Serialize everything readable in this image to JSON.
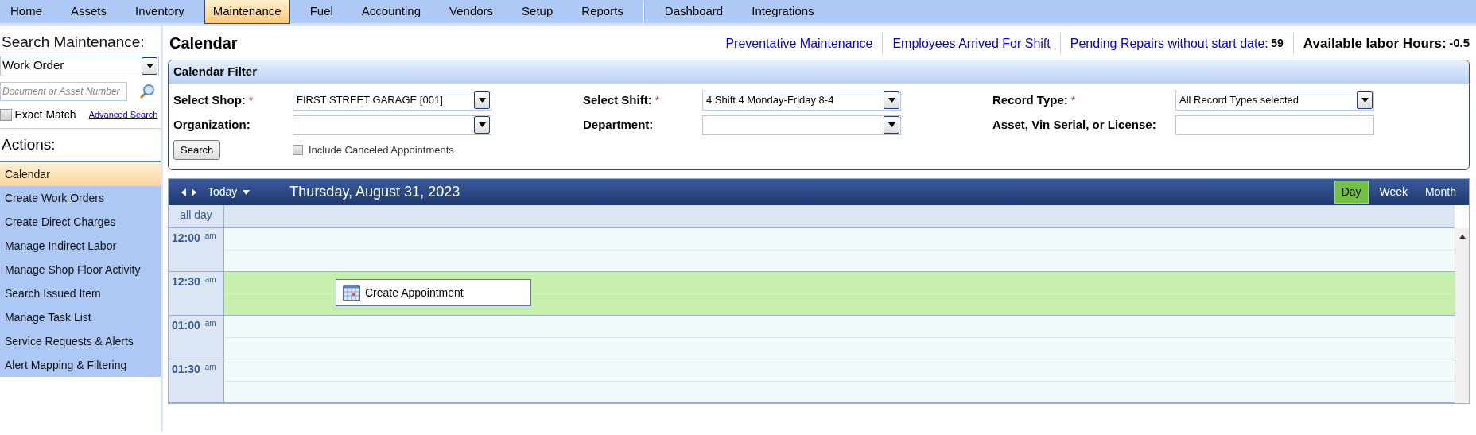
{
  "menu": {
    "main": [
      {
        "label": "Home",
        "selected": false
      },
      {
        "label": "Assets",
        "selected": false
      },
      {
        "label": "Inventory",
        "selected": false
      },
      {
        "label": "Maintenance",
        "selected": true
      },
      {
        "label": "Fuel",
        "selected": false
      },
      {
        "label": "Accounting",
        "selected": false
      },
      {
        "label": "Vendors",
        "selected": false
      },
      {
        "label": "Setup",
        "selected": false
      },
      {
        "label": "Reports",
        "selected": false
      }
    ],
    "extra": [
      {
        "label": "Dashboard",
        "selected": false
      },
      {
        "label": "Integrations",
        "selected": false
      }
    ]
  },
  "sidebar": {
    "search_title": "Search Maintenance:",
    "search_type": "Work Order",
    "search_field": {
      "placeholder": "Document or Asset Number"
    },
    "exact_match": {
      "label": "Exact Match",
      "checked": false
    },
    "advanced_link": "Advanced Search",
    "actions_title": "Actions:",
    "actions": [
      {
        "label": "Calendar",
        "selected": true
      },
      {
        "label": "Create Work Orders",
        "selected": false
      },
      {
        "label": "Create Direct Charges",
        "selected": false
      },
      {
        "label": "Manage Indirect Labor",
        "selected": false
      },
      {
        "label": "Manage Shop Floor Activity",
        "selected": false
      },
      {
        "label": "Search Issued Item",
        "selected": false
      },
      {
        "label": "Manage Task List",
        "selected": false
      },
      {
        "label": "Service Requests & Alerts",
        "selected": false
      },
      {
        "label": "Alert Mapping & Filtering",
        "selected": false
      }
    ]
  },
  "header": {
    "title": "Calendar",
    "links": [
      {
        "label": "Preventative Maintenance"
      },
      {
        "label": "Employees Arrived For Shift"
      },
      {
        "label": "Pending Repairs without start date:",
        "count": "59"
      }
    ],
    "labor_label": "Available labor Hours:",
    "labor_value": "-0.5"
  },
  "filter": {
    "title": "Calendar Filter",
    "fields": [
      {
        "label": "Select Shop:",
        "required_mark": "*",
        "kind": "select",
        "value": "FIRST STREET GARAGE [001]"
      },
      {
        "label": "Select Shift:",
        "required_mark": "*",
        "kind": "select",
        "value": "4 Shift 4 Monday-Friday 8-4"
      },
      {
        "label": "Record Type:",
        "required_mark": "*",
        "kind": "select",
        "value": "All Record Types selected"
      },
      {
        "label": "Organization:",
        "kind": "select"
      },
      {
        "label": "Department:",
        "kind": "select"
      },
      {
        "label": "Asset, Vin Serial, or License:",
        "kind": "text"
      }
    ],
    "search_button": "Search",
    "include_canceled": {
      "label": "Include Canceled Appointments",
      "checked": false
    }
  },
  "calendar": {
    "today": "Today",
    "date": "Thursday, August 31, 2023",
    "views": [
      {
        "label": "Day",
        "selected": true
      },
      {
        "label": "Week",
        "selected": false
      },
      {
        "label": "Month",
        "selected": false
      }
    ],
    "all_day": "all day",
    "slots": [
      {
        "time": "12:00",
        "ampm": "am",
        "highlighted": false
      },
      {
        "time": "12:30",
        "ampm": "am",
        "highlighted": true
      },
      {
        "time": "01:00",
        "ampm": "am",
        "highlighted": false
      },
      {
        "time": "01:30",
        "ampm": "am",
        "highlighted": false
      }
    ],
    "appointment_button": "Create Appointment"
  }
}
